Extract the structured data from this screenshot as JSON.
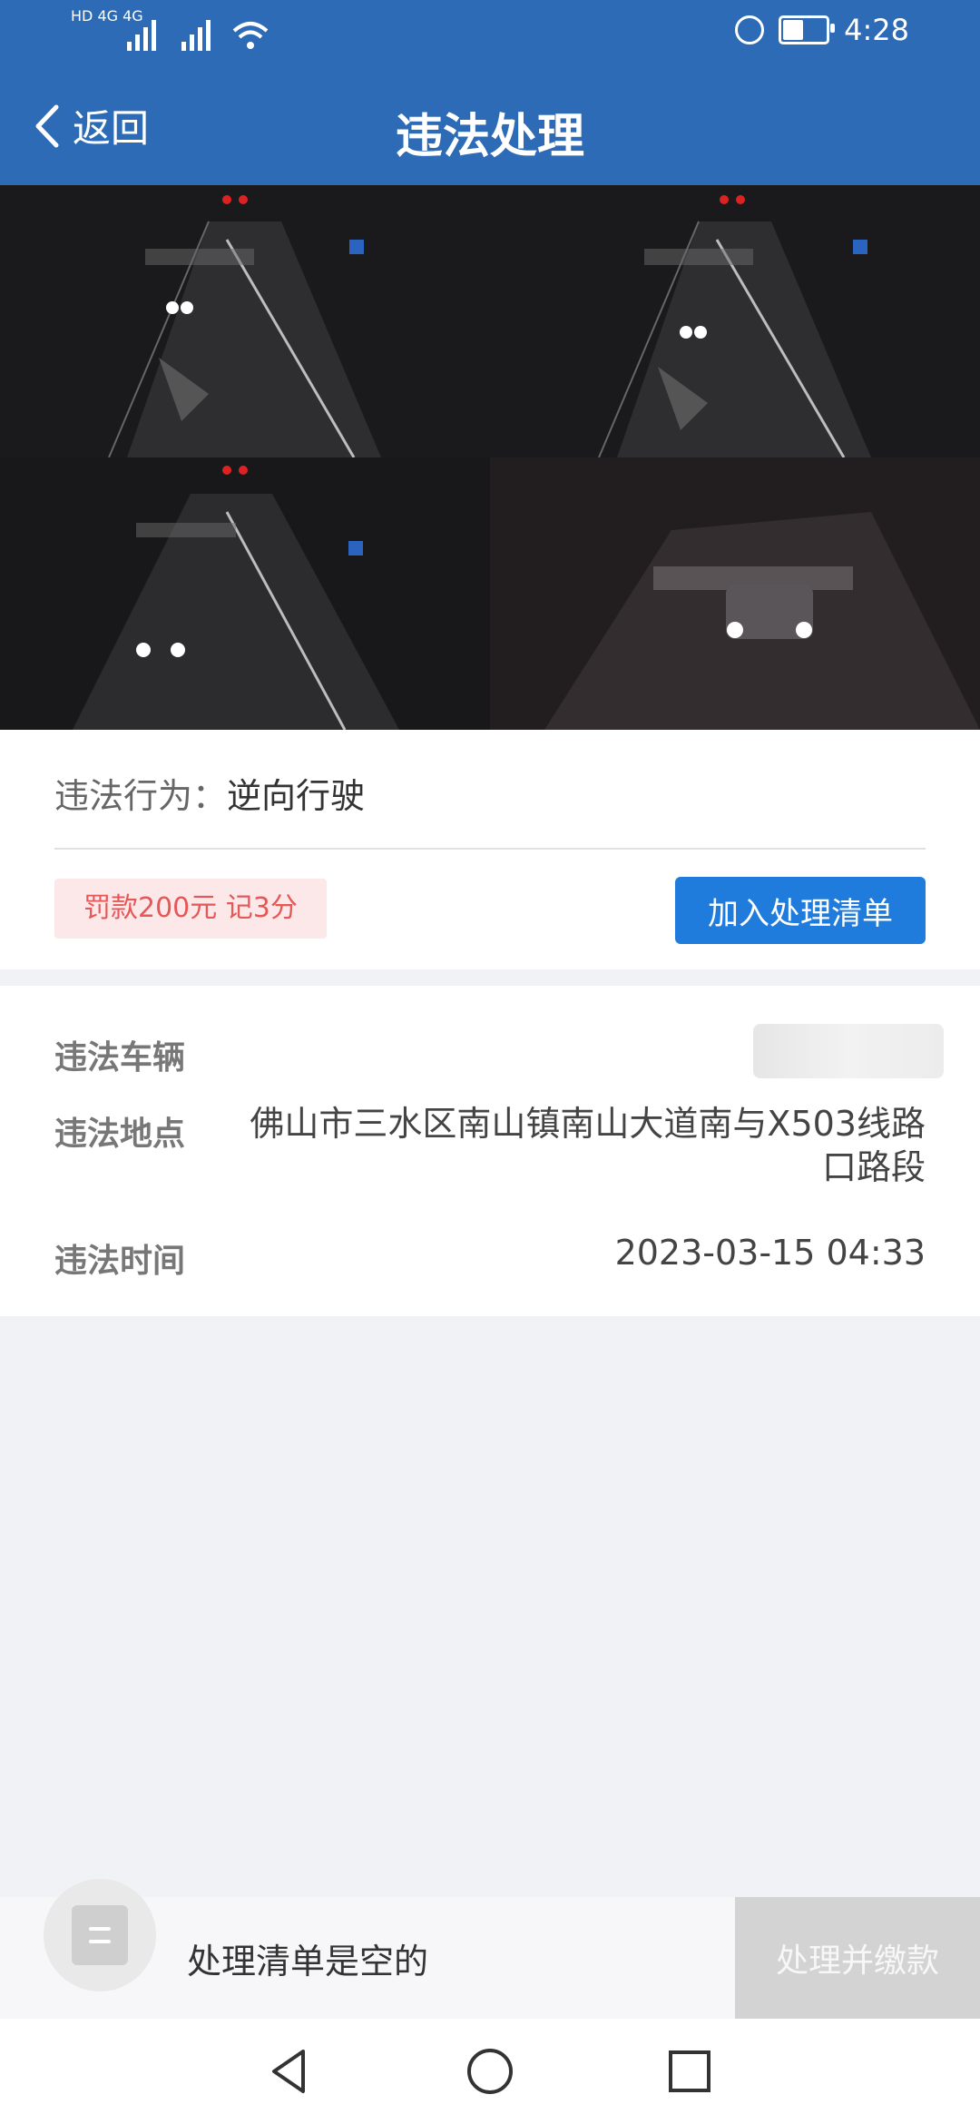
{
  "status": {
    "left_label": "HD 4G 4G",
    "time": "4:28",
    "battery_level": 0.55
  },
  "header": {
    "back_label": "返回",
    "title": "违法处理"
  },
  "violation": {
    "label": "违法行为：",
    "value": "逆向行驶",
    "penalty": "罚款200元 记3分",
    "add_button": "加入处理清单"
  },
  "details": {
    "vehicle_label": "违法车辆",
    "location_label": "违法地点",
    "location_value": "佛山市三水区南山镇南山大道南与X503线路口路段",
    "time_label": "违法时间",
    "time_value": "2023-03-15 04:33"
  },
  "checkout": {
    "empty_text": "处理清单是空的",
    "pay_button": "处理并缴款"
  },
  "icons": {
    "back": "chevron-left-icon",
    "list": "list-icon",
    "nav_back": "triangle-back-icon",
    "nav_home": "circle-home-icon",
    "nav_recent": "square-recent-icon"
  }
}
